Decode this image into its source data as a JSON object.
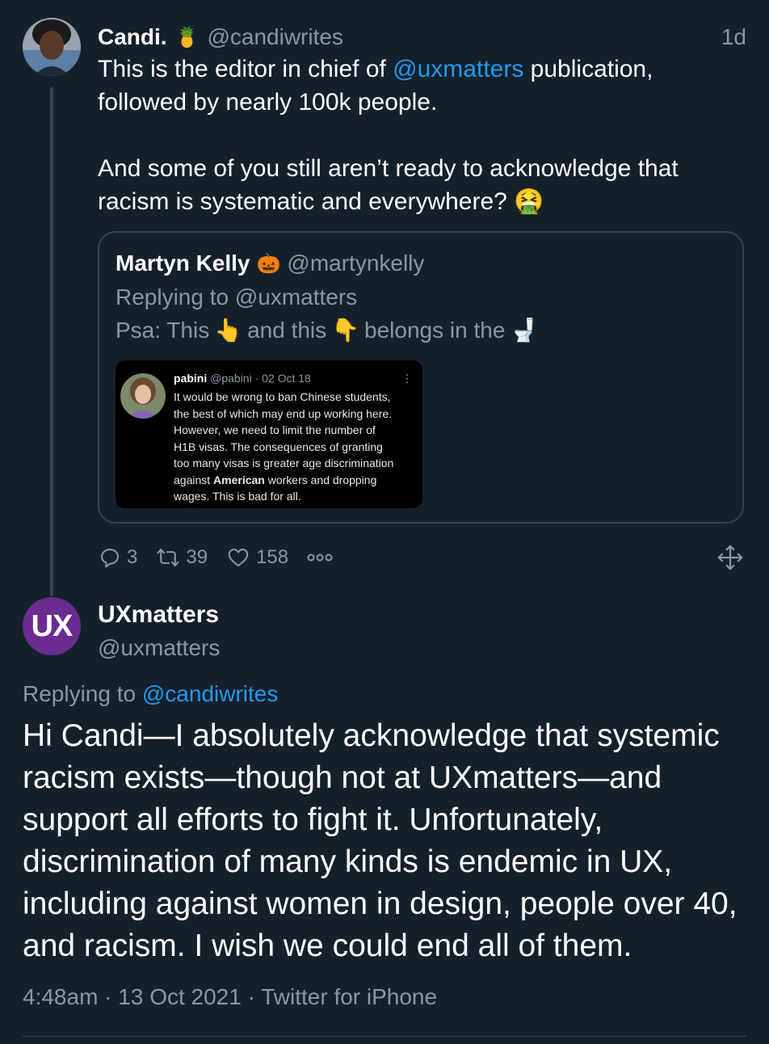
{
  "top_tweet": {
    "name": "Candi.",
    "name_emoji": "🍍",
    "handle": "@candiwrites",
    "time": "1d",
    "text_part1": "This is the editor in chief of ",
    "mention": "@uxmatters",
    "text_part2": " publication,\nfollowed by nearly 100k people.\n\nAnd some of you still aren’t ready to acknowledge that\nracism is systematic and everywhere? ",
    "text_emoji": "🤮"
  },
  "quote": {
    "name": "Martyn Kelly",
    "name_emoji": "🎃",
    "handle": "@martynkelly",
    "replying": "Replying to @uxmatters",
    "text_a": "Psa: This",
    "emoji_a": "👆",
    "text_b": "and this",
    "emoji_b": "👇",
    "text_c": "belongs in the",
    "emoji_c": "🚽",
    "screenshot": {
      "name": "pabini",
      "meta": " @pabini · 02 Oct 18",
      "dots": "⋮",
      "body_a": "It would be wrong to ban Chinese students,\nthe best of which may end up working here.\nHowever, we need to limit the number of\nH1B visas. The consequences of granting\ntoo many visas is greater age discrimination\nagainst ",
      "body_bold": "American",
      "body_b": " workers and dropping\nwages. This is bad for all."
    }
  },
  "actions": {
    "replies": "3",
    "retweets": "39",
    "likes": "158",
    "more_icon": "ellipsis-icon",
    "move_icon": "move-arrows-icon"
  },
  "main_tweet": {
    "avatar_text": "UX",
    "avatar_color": "#6a2c91",
    "name": "UXmatters",
    "handle": "@uxmatters",
    "replying_prefix": "Replying to ",
    "replying_mention": "@candiwrites",
    "text": "Hi Candi—I absolutely acknowledge that systemic racism exists—though not at UXmatters—and support all efforts to fight it. Unfortunately, discrimination of many kinds is endemic in UX, including against women in design, people over 40, and racism. I wish we could end all of them.",
    "meta": "4:48am · 13 Oct 2021 · Twitter for iPhone"
  },
  "colors": {
    "background": "#15202b",
    "link": "#1d9bf0",
    "muted": "#8899a6",
    "border": "#38444d"
  }
}
